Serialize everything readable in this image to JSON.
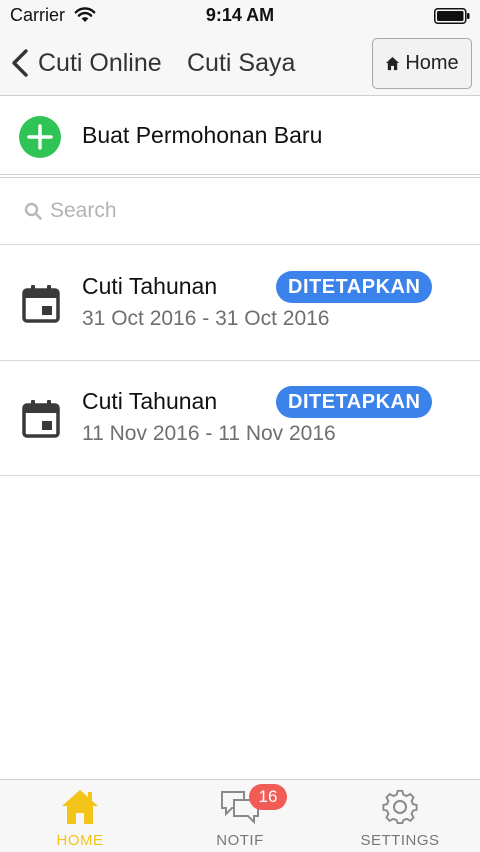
{
  "status_bar": {
    "carrier": "Carrier",
    "time": "9:14 AM"
  },
  "nav": {
    "back_label": "Cuti Online",
    "title": "Cuti Saya",
    "home_button": "Home"
  },
  "new_request": {
    "label": "Buat Permohonan Baru",
    "icon": "plus-circle-icon",
    "color": "#2fc455"
  },
  "search": {
    "placeholder": "Search",
    "value": ""
  },
  "leave_list": [
    {
      "title": "Cuti Tahunan",
      "date_range": "31 Oct 2016 - 31 Oct 2016",
      "status": "DITETAPKAN"
    },
    {
      "title": "Cuti Tahunan",
      "date_range": "11 Nov 2016 - 11 Nov 2016",
      "status": "DITETAPKAN"
    }
  ],
  "colors": {
    "badge": "#3b82ea",
    "active_tab": "#f5c419",
    "notif_badge": "#f15c56"
  },
  "tabs": [
    {
      "label": "HOME",
      "icon": "home-icon",
      "active": true
    },
    {
      "label": "NOTIF",
      "icon": "chat-bubbles-icon",
      "active": false,
      "badge": "16"
    },
    {
      "label": "SETTINGS",
      "icon": "gear-icon",
      "active": false
    }
  ]
}
